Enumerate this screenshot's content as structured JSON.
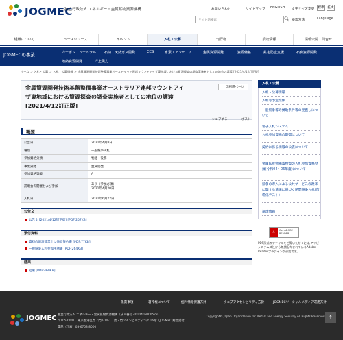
{
  "header": {
    "logo_text": "JOGMEC",
    "org_name": "独立行政法人 エネルギー・金属鉱物資源機構",
    "util_links": [
      "お問い合わせ",
      "サイトマップ",
      "ENGLISH"
    ],
    "font_size_label": "文字サイズ変更",
    "font_sizes": [
      "標準",
      "拡大"
    ],
    "search_placeholder": "サイト内検索",
    "search_method": "検索方法",
    "language": "Language"
  },
  "gnav": [
    "組織について",
    "ニュースリリース",
    "イベント",
    "入札・公募",
    "刊行物",
    "調達情報",
    "情報公開・問合せ"
  ],
  "subnav": {
    "title": "JOGMECの事業",
    "row1": [
      "カーボンニュートラル",
      "石油・天然ガス開発",
      "CCS",
      "水素・アンモニア",
      "金属資源開発",
      "資源備蓄",
      "鉱害防止支援",
      "石炭資源開発"
    ],
    "row2": [
      "地熱資源開発",
      "洋上風力"
    ]
  },
  "breadcrumb": "ホーム ＞ 入札・公募 ＞ 入札・公募情報 ＞ 金属資源開発技術整備事業オーストラリア連邦マウントアイザ東地域における資源探査の調査実施者としての地位の譲渡 [2021/4/12訂正版]",
  "page": {
    "title": "金属資源開発技術基盤整備事業オーストラリア連邦マウントアイザ東地域における資源探査の調査実施者としての地位の譲渡 [2021/4/12訂正版]",
    "print_label": "印刷用ページ",
    "share_label": "シェアする",
    "post_label": "ポスト",
    "overview_heading": "概要",
    "table": [
      {
        "k": "公告日",
        "v": "2021年4月8日"
      },
      {
        "k": "種別",
        "v": "一般競争入札"
      },
      {
        "k": "参加資格分類",
        "v": "物品・役務"
      },
      {
        "k": "事業分野",
        "v": "金属開発"
      },
      {
        "k": "参加資格等級",
        "v": "A"
      },
      {
        "k": "説明会の開催および参加",
        "v": "あり（参加必須）",
        "v2": "2021年4月20日"
      },
      {
        "k": "入札日",
        "v": "2021年6月22日"
      }
    ]
  },
  "sections": [
    {
      "heading": "公告文",
      "links": [
        "公告文 [2021/4/12訂正版] [PDF:257KB]"
      ]
    },
    {
      "heading": "添付資料",
      "links": [
        "資料の譲渡等禁止に係る誓約書 [PDF:77KB]",
        "一般競争入札参加申請書 [PDF:264KB]"
      ]
    },
    {
      "heading": "結果",
      "links": [
        "結果 [PDF:469KB]"
      ]
    }
  ],
  "sidebar": {
    "heading": "入札・公募",
    "items": [
      "入札・公募情報",
      "入札等予定案件",
      "一般競争等の賛助条件等の見直しについて",
      "電子入札システム",
      "入札参加資格の取得について",
      "契約に係る情報の公表について",
      "金属鉱産物備蓄物資の入札参加資格登録(令和04〜06年度)について",
      "競争の導入による公共サービスの改革に関する法律に基づく民間競争入札(市場化テスト)",
      "調達情報"
    ],
    "adobe_label": "Get ADOBE READER",
    "adobe_note": "PDF形式のファイルをご覧いただくには,アドビシステムズ社から無償配布されているAdobe Readerプラグインが必要です。"
  },
  "footer": {
    "links": [
      "免責事項",
      "著作権について",
      "個人情報保護方針",
      "ウェブアクセシビリティ方針",
      "JOGMECソーシャルメディア運用方針"
    ],
    "logo_text": "JOGMEC",
    "address": [
      "独立行政法人 エネルギー・金属鉱物資源機構（法人番号 4010405000573）",
      "〒105-0001　東京都港区虎ノ門2-10-1　虎ノ門ツインビルディング 16階（JOGMEC 総合受付）",
      "電話（代表）03-6758-8000"
    ],
    "copyright": "Copyright© Japan Organization for Metals and Energy Security All Rights Reserved.",
    "totop": "↑"
  },
  "colors": {
    "navy": "#0a2f73",
    "link": "#1a4fa0",
    "footer_bg": "#2b2b2b",
    "pdf_icon": "#cc0000"
  }
}
